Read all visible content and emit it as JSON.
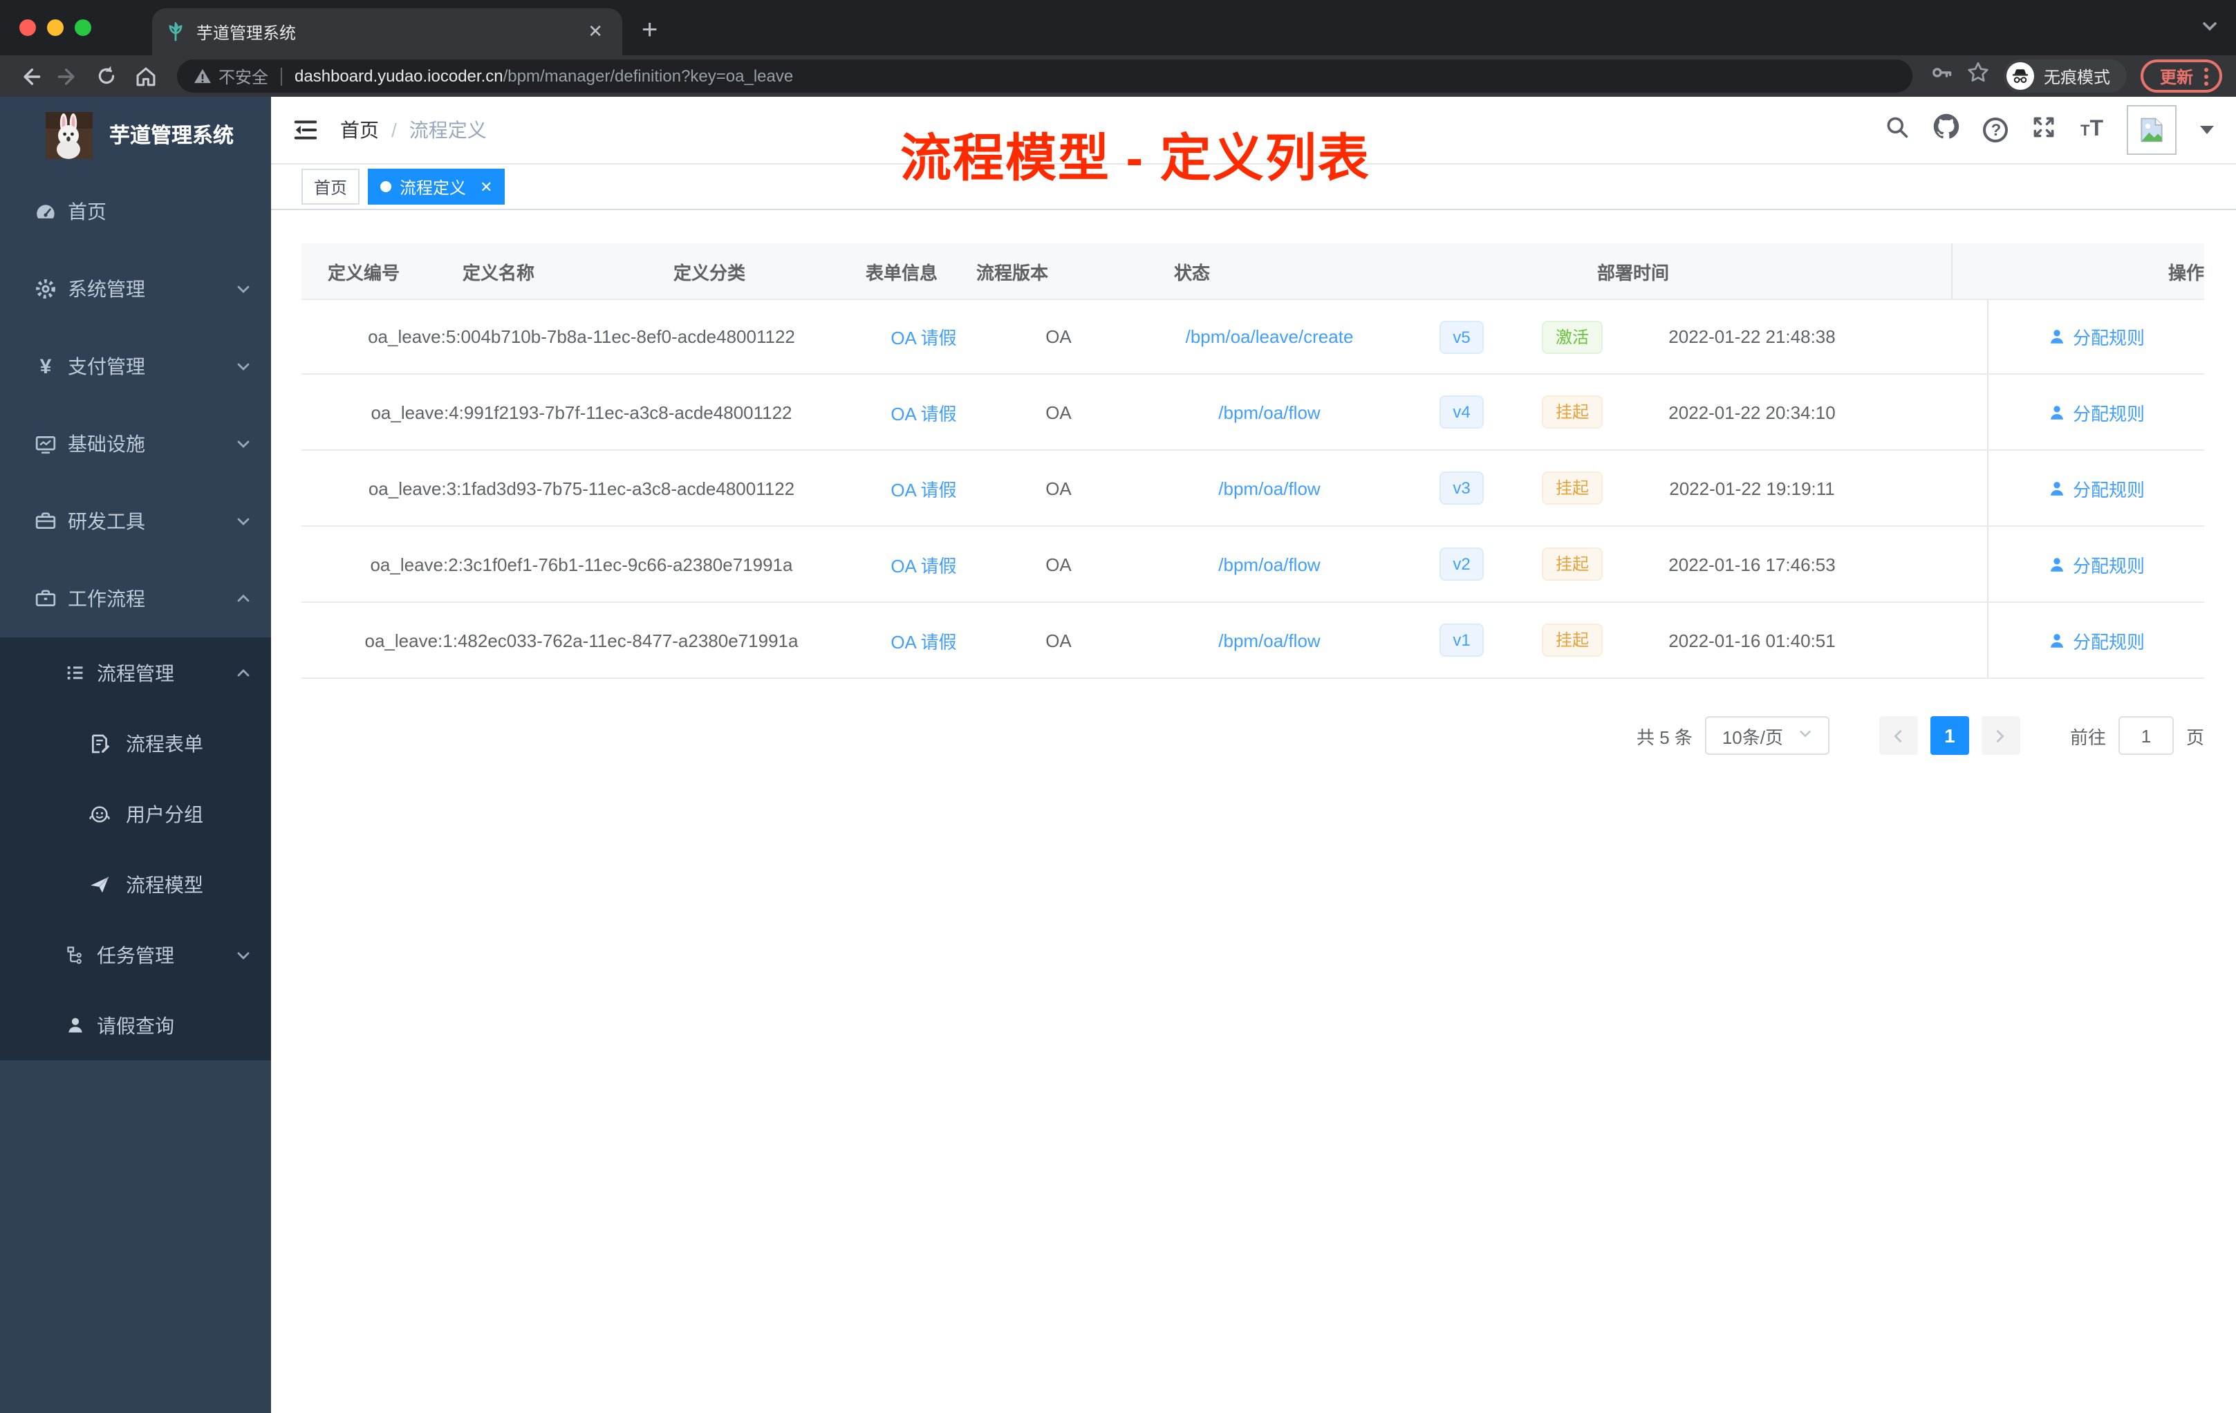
{
  "colors": {
    "accent": "#1890ff",
    "link": "#409eff",
    "success": "#67c23a",
    "warning": "#e6a23c",
    "annotation_red": "#ff2b00",
    "sidebar_bg": "#304156",
    "submenu_bg": "#1f2d3d"
  },
  "browser": {
    "tab_title": "芋道管理系统",
    "insecure_label": "不安全",
    "url_host": "dashboard.yudao.iocoder.cn",
    "url_path": "/bpm/manager/definition?key=oa_leave",
    "incognito_label": "无痕模式",
    "update_label": "更新"
  },
  "sidebar": {
    "app_title": "芋道管理系统",
    "menu": {
      "home": "首页",
      "system": "系统管理",
      "payment": "支付管理",
      "infra": "基础设施",
      "devtools": "研发工具",
      "workflow": "工作流程",
      "process_mgmt": "流程管理",
      "process_form": "流程表单",
      "user_group": "用户分组",
      "process_model": "流程模型",
      "task_mgmt": "任务管理",
      "leave_query": "请假查询"
    }
  },
  "navbar": {
    "breadcrumb_home": "首页",
    "breadcrumb_current": "流程定义",
    "annotation": "流程模型 - 定义列表"
  },
  "tags": {
    "home": "首页",
    "active": "流程定义"
  },
  "table": {
    "headers": [
      "定义编号",
      "定义名称",
      "定义分类",
      "表单信息",
      "流程版本",
      "状态",
      "部署时间",
      "",
      "操作"
    ],
    "op_label": "分配规则",
    "rows": [
      {
        "id": "oa_leave:5:004b710b-7b8a-11ec-8ef0-acde48001122",
        "name": "OA 请假",
        "category": "OA",
        "form": "/bpm/oa/leave/create",
        "version": "v5",
        "status": "激活",
        "status_kind": "active",
        "deploy_time": "2022-01-22 21:48:38"
      },
      {
        "id": "oa_leave:4:991f2193-7b7f-11ec-a3c8-acde48001122",
        "name": "OA 请假",
        "category": "OA",
        "form": "/bpm/oa/flow",
        "version": "v4",
        "status": "挂起",
        "status_kind": "suspended",
        "deploy_time": "2022-01-22 20:34:10"
      },
      {
        "id": "oa_leave:3:1fad3d93-7b75-11ec-a3c8-acde48001122",
        "name": "OA 请假",
        "category": "OA",
        "form": "/bpm/oa/flow",
        "version": "v3",
        "status": "挂起",
        "status_kind": "suspended",
        "deploy_time": "2022-01-22 19:19:11"
      },
      {
        "id": "oa_leave:2:3c1f0ef1-76b1-11ec-9c66-a2380e71991a",
        "name": "OA 请假",
        "category": "OA",
        "form": "/bpm/oa/flow",
        "version": "v2",
        "status": "挂起",
        "status_kind": "suspended",
        "deploy_time": "2022-01-16 17:46:53"
      },
      {
        "id": "oa_leave:1:482ec033-762a-11ec-8477-a2380e71991a",
        "name": "OA 请假",
        "category": "OA",
        "form": "/bpm/oa/flow",
        "version": "v1",
        "status": "挂起",
        "status_kind": "suspended",
        "deploy_time": "2022-01-16 01:40:51"
      }
    ]
  },
  "pagination": {
    "total_label": "共 5 条",
    "page_size_label": "10条/页",
    "current_page": "1",
    "goto_label": "前往",
    "goto_value": "1",
    "page_unit": "页"
  }
}
